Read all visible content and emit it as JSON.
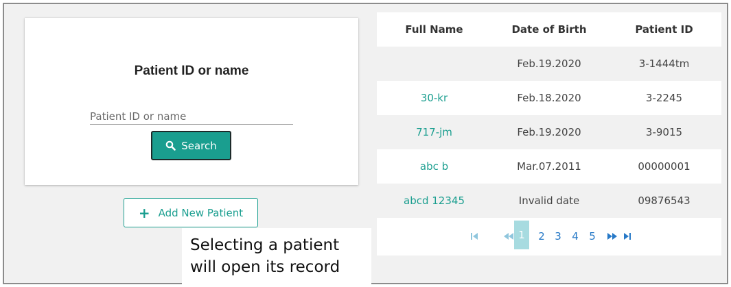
{
  "search": {
    "title": "Patient ID or name",
    "placeholder": "Patient ID or name",
    "button_label": "Search"
  },
  "add_patient": {
    "label": "Add New Patient"
  },
  "caption": {
    "line1": "Selecting a patient",
    "line2": "will open its record"
  },
  "table": {
    "headers": [
      "Full Name",
      "Date of Birth",
      "Patient ID"
    ],
    "rows": [
      {
        "name": "",
        "dob": "Feb.19.2020",
        "id": "3-1444tm"
      },
      {
        "name": "30-kr",
        "dob": "Feb.18.2020",
        "id": "3-2245"
      },
      {
        "name": "717-jm",
        "dob": "Feb.19.2020",
        "id": "3-9015"
      },
      {
        "name": "abc b",
        "dob": "Mar.07.2011",
        "id": "00000001"
      },
      {
        "name": "abcd 12345",
        "dob": "Invalid date",
        "id": "09876543"
      }
    ]
  },
  "pagination": {
    "pages": [
      "1",
      "2",
      "3",
      "4",
      "5"
    ],
    "current": "1",
    "icons": [
      "first-page-icon",
      "previous-page-icon",
      "next-page-icon",
      "last-page-icon"
    ]
  },
  "colors": {
    "accent": "#1a9e8f",
    "page_link": "#2779c7",
    "current_page_bg": "#a7dbe0",
    "panel_bg": "#f1f1f1"
  }
}
